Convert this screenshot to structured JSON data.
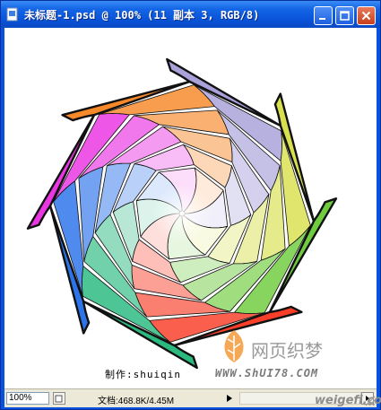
{
  "window": {
    "title": "未标题-1.psd @ 100% (11 副本 3, RGB/8)",
    "icons": [
      "ps-document-icon",
      "minimize-icon",
      "maximize-icon",
      "close-icon"
    ]
  },
  "canvas": {
    "credit": "制作:shuiqin",
    "watermark_url": "WWW.ShUI78.COM",
    "watermark_brand": "网页织梦",
    "petal_colors": [
      "#9f97d6",
      "#d4dc3c",
      "#5fc62a",
      "#f82a12",
      "#12b272",
      "#1464e8",
      "#e81ee0",
      "#f67c12"
    ]
  },
  "statusbar": {
    "zoom": "100%",
    "doc_info": "文档:468.8K/4.45M",
    "site_watermark": "weigefi.com"
  }
}
